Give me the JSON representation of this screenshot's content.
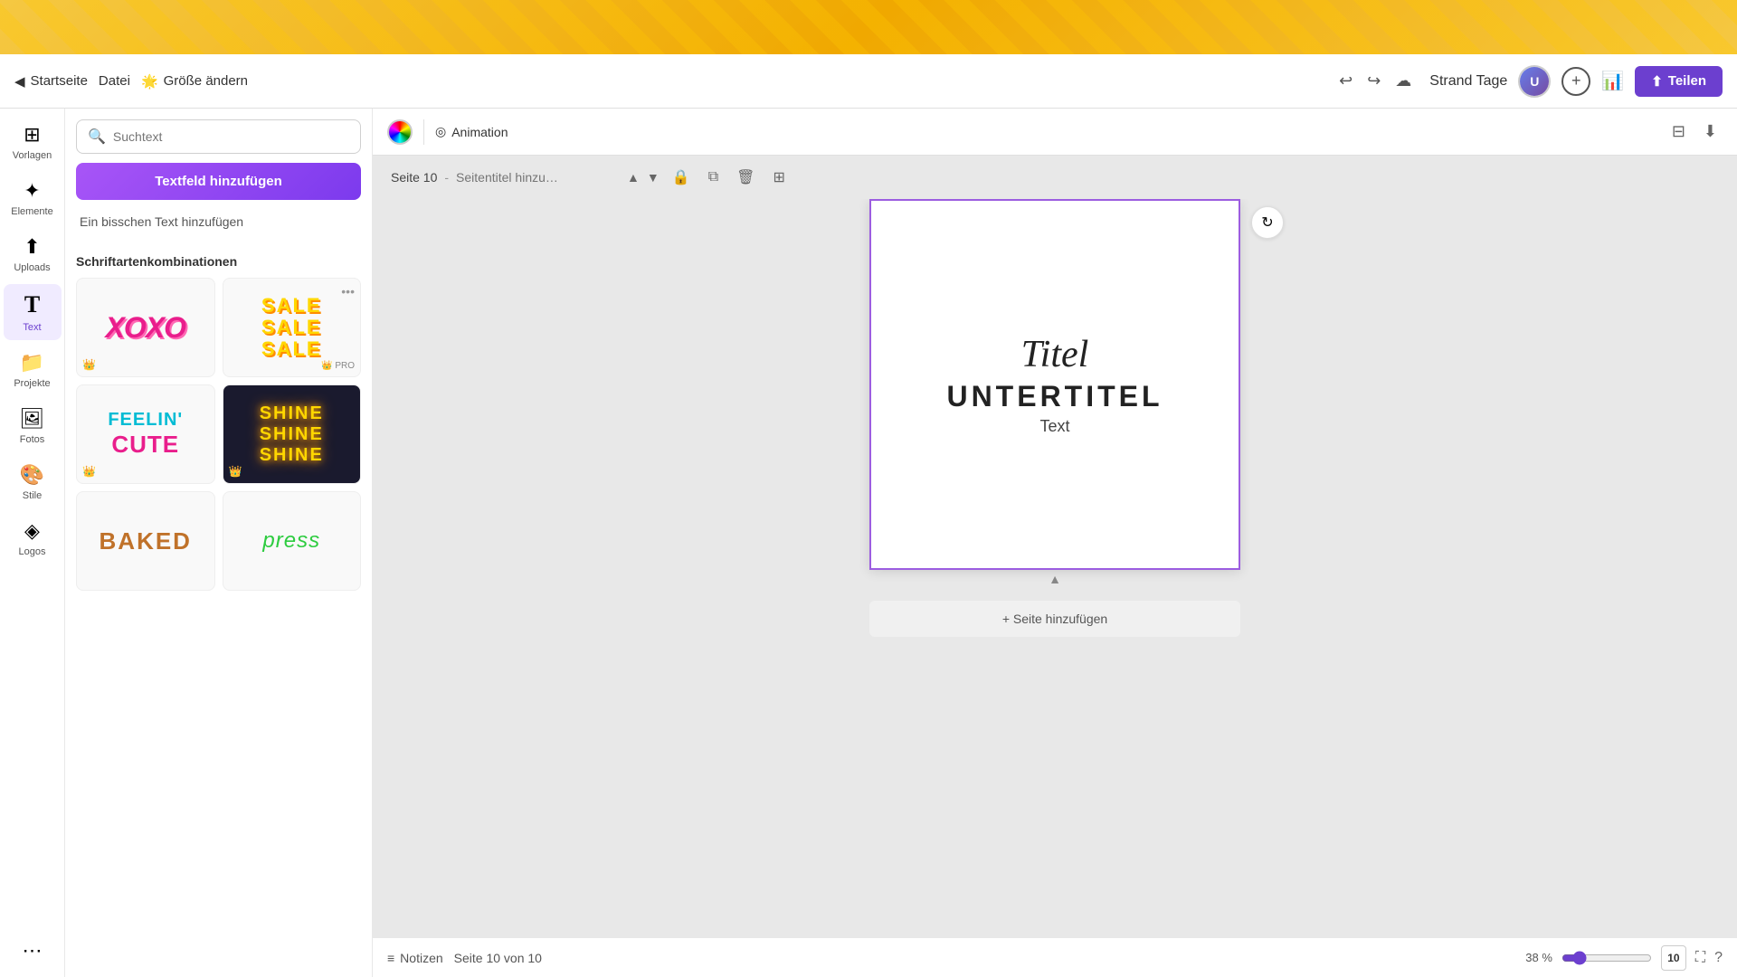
{
  "topBar": {},
  "header": {
    "back_label": "Startseite",
    "file_label": "Datei",
    "resize_icon": "🌟",
    "resize_label": "Größe ändern",
    "undo_icon": "↩",
    "redo_icon": "↪",
    "cloud_icon": "☁",
    "project_title": "Strand Tage",
    "share_label": "Teilen"
  },
  "sidebar": {
    "items": [
      {
        "id": "vorlagen",
        "icon": "⊞",
        "label": "Vorlagen"
      },
      {
        "id": "elemente",
        "icon": "✦",
        "label": "Elemente"
      },
      {
        "id": "uploads",
        "icon": "⬆",
        "label": "Uploads"
      },
      {
        "id": "text",
        "icon": "T",
        "label": "Text",
        "active": true
      },
      {
        "id": "projekte",
        "icon": "📁",
        "label": "Projekte"
      },
      {
        "id": "fotos",
        "icon": "🖼",
        "label": "Fotos"
      },
      {
        "id": "stile",
        "icon": "🎨",
        "label": "Stile"
      },
      {
        "id": "logos",
        "icon": "◈",
        "label": "Logos"
      },
      {
        "id": "apps",
        "icon": "⋯",
        "label": ""
      }
    ]
  },
  "textPanel": {
    "search_placeholder": "Suchtext",
    "add_text_label": "Textfeld hinzufügen",
    "small_text_label": "Ein bisschen Text hinzufügen",
    "section_title": "Schriftartenkombinationen",
    "fonts": [
      {
        "id": "xoxo",
        "display": "XOXO",
        "style": "xoxo",
        "has_pro": false,
        "has_download": true,
        "has_more": false
      },
      {
        "id": "sale",
        "display": "SALE",
        "style": "sale",
        "has_pro": true,
        "has_download": false,
        "has_more": true
      },
      {
        "id": "feelin-cute",
        "display": "FEELIN CUTE",
        "style": "feelin-cute",
        "has_pro": false,
        "has_download": true,
        "has_more": false
      },
      {
        "id": "shine",
        "display": "SHINE",
        "style": "shine",
        "has_pro": false,
        "has_download": true,
        "has_more": false
      },
      {
        "id": "baked",
        "display": "BAKED",
        "style": "baked",
        "has_pro": false,
        "has_download": false,
        "has_more": false
      },
      {
        "id": "press",
        "display": "press",
        "style": "press",
        "has_pro": false,
        "has_download": false,
        "has_more": false
      }
    ]
  },
  "canvasToolbar": {
    "animation_label": "Animation",
    "filter_icon": "⊟",
    "download_icon": "⬇"
  },
  "pageHeader": {
    "page_label": "Seite 10",
    "page_subtitle": "Seitentitel hinzu…"
  },
  "canvas": {
    "title": "Titel",
    "subtitle": "UNTERTITEL",
    "text": "Text"
  },
  "statusBar": {
    "notes_label": "Notizen",
    "page_info": "Seite 10 von 10",
    "zoom_level": "38 %",
    "zoom_value": 38,
    "add_page_label": "+ Seite hinzufügen",
    "page_num": "10"
  }
}
